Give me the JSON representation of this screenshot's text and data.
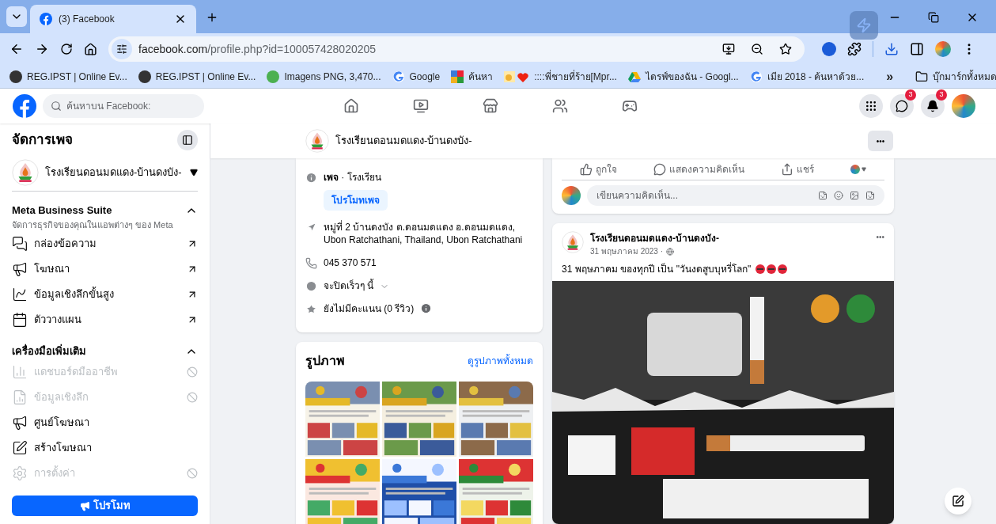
{
  "browser": {
    "tabs": [
      {
        "title": "(3) Facebook",
        "selected": true
      }
    ],
    "url_host": "facebook.com",
    "url_path": "/profile.php?id=100057428020205",
    "bookmarks": [
      {
        "label": "REG.IPST | Online Ev...",
        "kind": "sf"
      },
      {
        "label": "REG.IPST | Online Ev...",
        "kind": "sf"
      },
      {
        "label": "Imagens PNG, 3,470...",
        "kind": "green"
      },
      {
        "label": "Google",
        "kind": "google"
      },
      {
        "label": "ค้นหา",
        "kind": "blocks"
      },
      {
        "label": "::::พี่ชายที่ร้าย[Mpr...",
        "kind": "heart"
      },
      {
        "label": "ไดรฟ์ของฉัน - Googl...",
        "kind": "drive"
      },
      {
        "label": "เมีย 2018 - ค้นหาด้วย...",
        "kind": "google"
      }
    ],
    "overflow": "»",
    "all_bookmarks": "บุ๊กมาร์กทั้งหมด"
  },
  "facebook": {
    "search": {
      "placeholder": "ค้นหาบน Facebook:"
    },
    "nav": [
      {
        "kind": "home",
        "selected": false
      },
      {
        "kind": "video",
        "selected": false
      },
      {
        "kind": "store",
        "selected": false
      },
      {
        "kind": "groups",
        "selected": false
      },
      {
        "kind": "gaming",
        "selected": false
      }
    ],
    "messenger_badge": "3",
    "notifications_badge": "3"
  },
  "sidebar": {
    "title": "จัดการเพจ",
    "page_name": "โรงเรียนดอนมดแดง-บ้านดงบัง-",
    "sections": [
      {
        "title": "Meta Business Suite",
        "subtitle": "จัดการธุรกิจของคุณในแอพต่างๆ ของ Meta",
        "expanded": true,
        "items": [
          {
            "label": "กล่องข้อความ",
            "kind": "chat",
            "disabled": false,
            "external": true
          },
          {
            "label": "โฆษณา",
            "kind": "megaphone",
            "disabled": false,
            "external": true
          },
          {
            "label": "ข้อมูลเชิงลึกขั้นสูง",
            "kind": "chart",
            "disabled": false,
            "external": true
          },
          {
            "label": "ตัววางแผน",
            "kind": "calendar",
            "disabled": false,
            "external": true
          }
        ]
      },
      {
        "title": "เครื่องมือเพิ่มเติม",
        "expanded": true,
        "items": [
          {
            "label": "แดชบอร์ดมืออาชีพ",
            "kind": "bars",
            "disabled": true,
            "external": false
          },
          {
            "label": "ข้อมูลเชิงลึก",
            "kind": "insights",
            "disabled": true,
            "external": false
          },
          {
            "label": "ศูนย์โฆษณา",
            "kind": "megaphone",
            "disabled": false,
            "external": false
          },
          {
            "label": "สร้างโฆษณา",
            "kind": "edit",
            "disabled": false,
            "external": false
          },
          {
            "label": "การตั้งค่า",
            "kind": "gear",
            "disabled": true,
            "external": false
          }
        ]
      }
    ],
    "promote_button": "โปรโมท"
  },
  "page_header": {
    "name": "โรงเรียนดอนมดแดง-บ้านดงบัง-",
    "more": "•••"
  },
  "intro": {
    "items": [
      {
        "kind": "info",
        "text": "**เพจ** · โรงเรียน"
      },
      {
        "kind": "address",
        "text": "หมู่ที่ 2 บ้านดงบัง ต.ดอนมดแดง อ.ดอนมดแดง, Ubon Ratchathani, Thailand, Ubon Ratchathani"
      },
      {
        "kind": "phone",
        "text": "045 370 571"
      },
      {
        "kind": "hours",
        "text": "จะปิดเร็วๆ นี้"
      },
      {
        "kind": "rating",
        "text": "ยังไม่มีคะแนน (0 รีวิว)"
      }
    ],
    "promote_page": "โปรโมทเพจ"
  },
  "photos": {
    "title": "รูปภาพ",
    "see_all": "ดูรูปภาพทั้งหมด"
  },
  "prev_post_actions": {
    "like": "ถูกใจ",
    "comment": "แสดงความคิดเห็น",
    "share": "แชร์",
    "comment_placeholder": "เขียนความคิดเห็น..."
  },
  "post": {
    "author": "โรงเรียนดอนมดแดง-บ้านดงบัง-",
    "date": "31 พฤษภาคม 2023 ·",
    "text": "31 พฤษภาคม ของทุกปี เป็น \"วันงดสูบบุหรี่โลก\"",
    "more": "•••"
  }
}
